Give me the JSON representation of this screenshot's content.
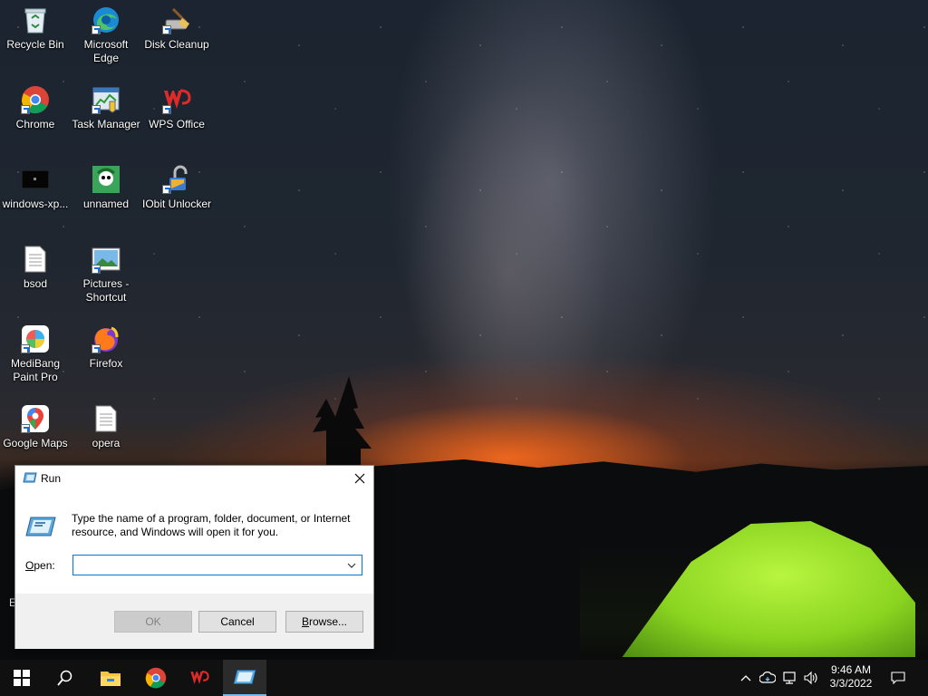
{
  "desktop": {
    "icons": [
      {
        "label": "Recycle Bin"
      },
      {
        "label": "Microsoft Edge"
      },
      {
        "label": "Disk Cleanup"
      },
      {
        "label": "Chrome"
      },
      {
        "label": "Task Manager"
      },
      {
        "label": "WPS Office"
      },
      {
        "label": "windows-xp..."
      },
      {
        "label": "unnamed"
      },
      {
        "label": "IObit Unlocker"
      },
      {
        "label": "bsod"
      },
      {
        "label": "Pictures - Shortcut"
      },
      {
        "label": "MediBang Paint Pro"
      },
      {
        "label": "Firefox"
      },
      {
        "label": "Google Maps"
      },
      {
        "label": "opera"
      }
    ],
    "partial_text": "E"
  },
  "run_dialog": {
    "title": "Run",
    "description": "Type the name of a program, folder, document, or Internet resource, and Windows will open it for you.",
    "open_label_prefix": "O",
    "open_label_rest": "pen:",
    "input_value": "",
    "ok_label": "OK",
    "cancel_label": "Cancel",
    "browse_label_prefix": "B",
    "browse_label_rest": "rowse..."
  },
  "taskbar": {
    "time": "9:46 AM",
    "date": "3/3/2022"
  },
  "colors": {
    "accent": "#0078d7",
    "taskbar": "#101010",
    "active_indicator": "#76b9ed"
  }
}
